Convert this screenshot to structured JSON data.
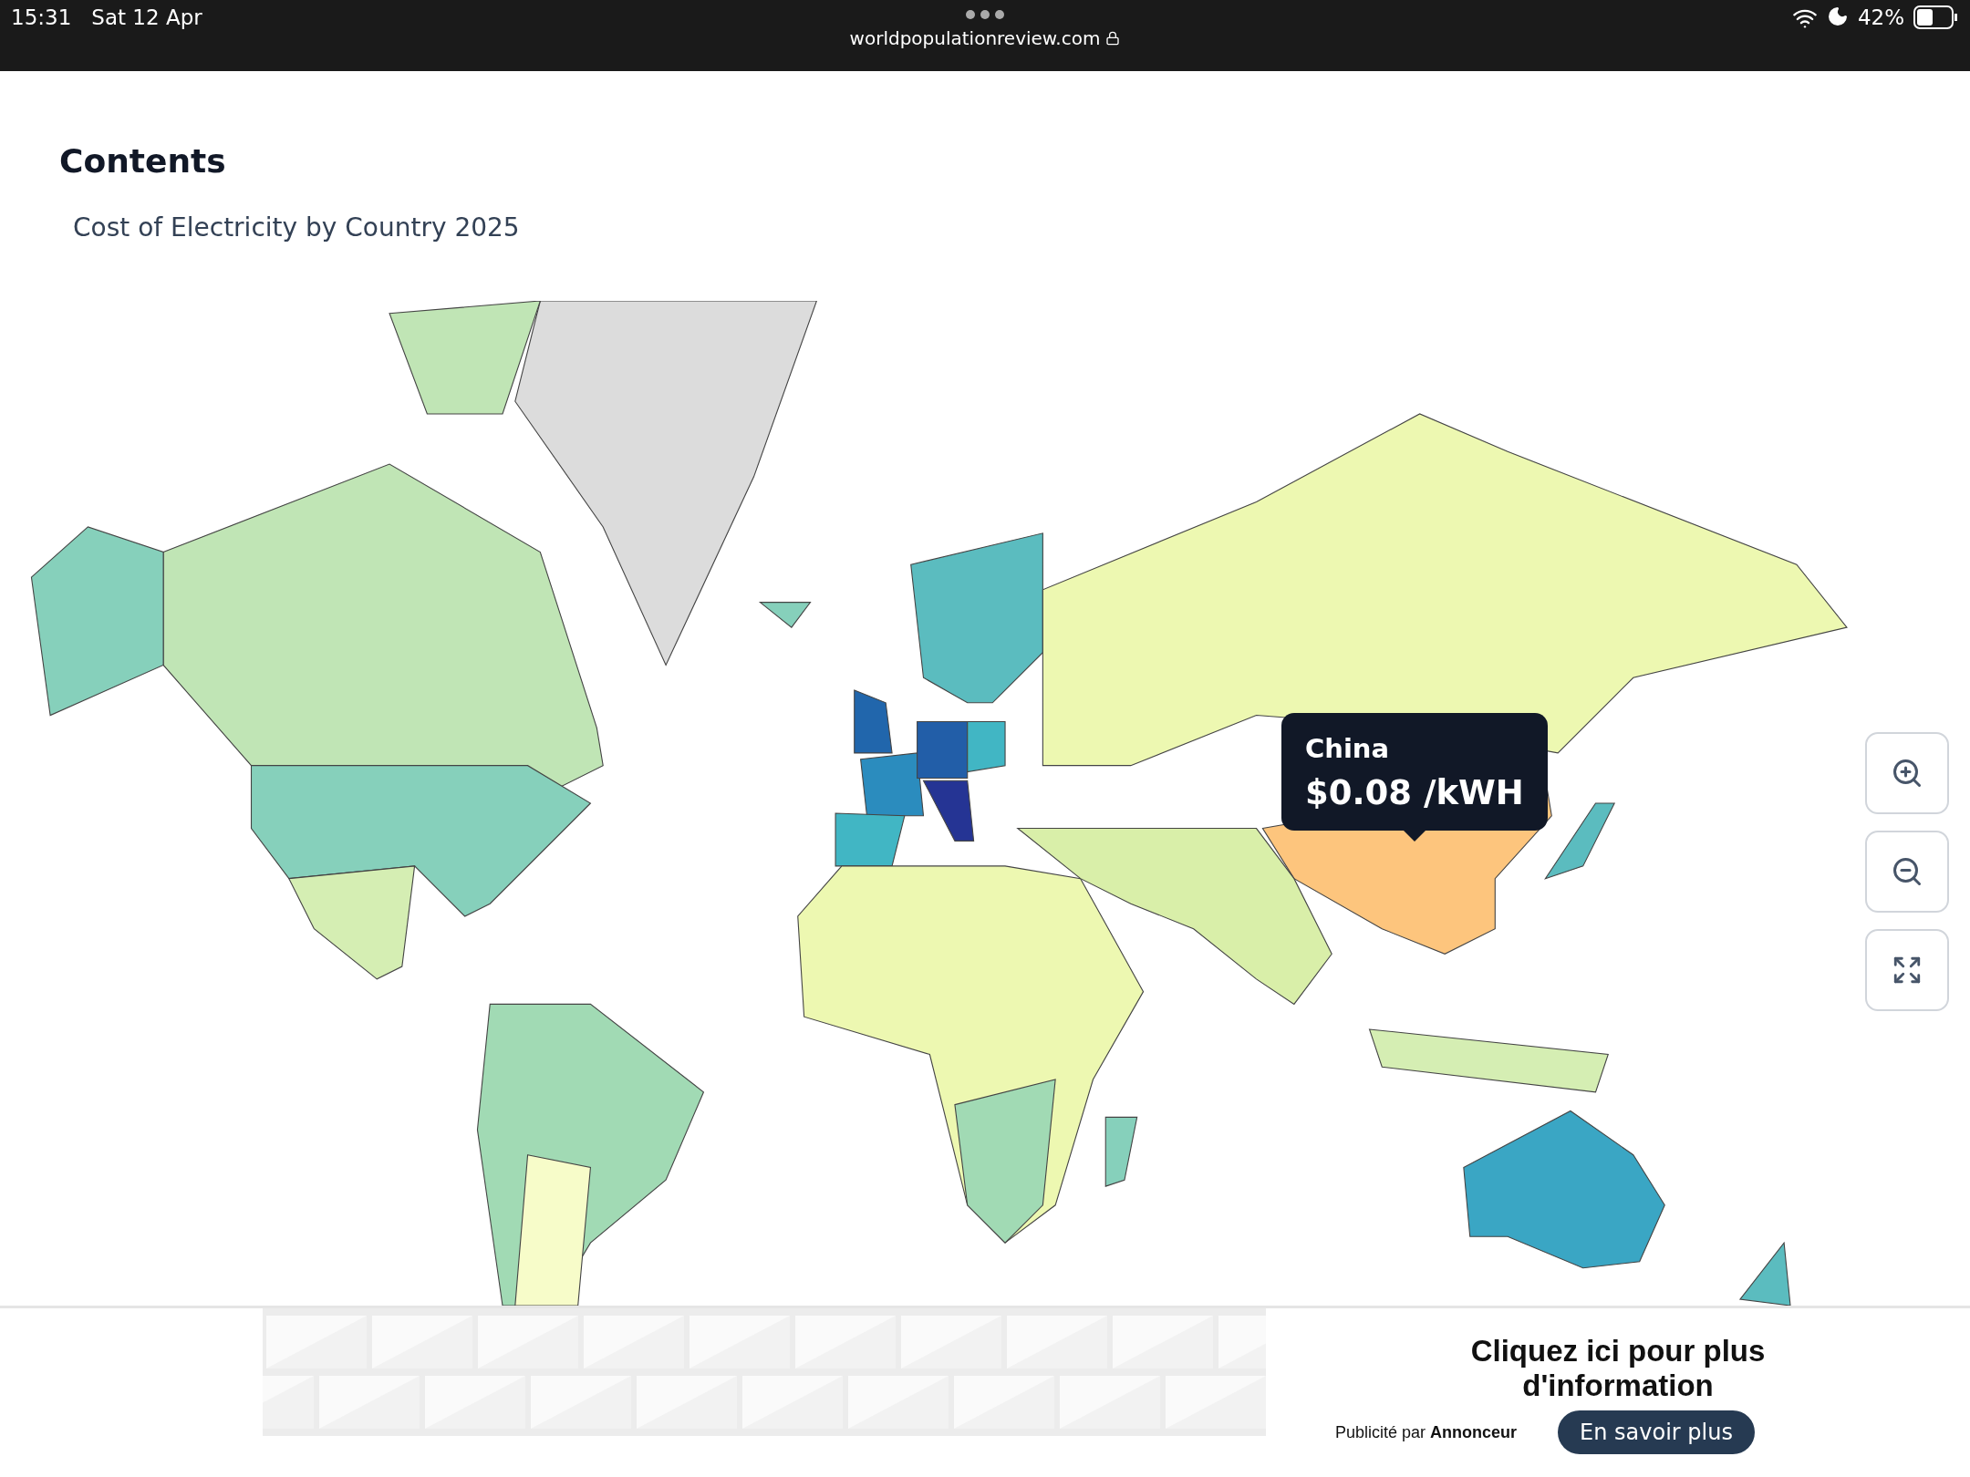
{
  "status_bar": {
    "time": "15:31",
    "date": "Sat 12 Apr",
    "url": "worldpopulationreview.com",
    "battery": "42%"
  },
  "contents": {
    "title": "Contents",
    "items": [
      "Cost of Electricity by Country 2025"
    ]
  },
  "map": {
    "tooltip": {
      "country": "China",
      "value": "$0.08 /kWH"
    }
  },
  "ad": {
    "headline": "Cliquez ici pour plus d'information",
    "credit": "Publicité par **Annonceur**",
    "button": "En savoir plus"
  }
}
